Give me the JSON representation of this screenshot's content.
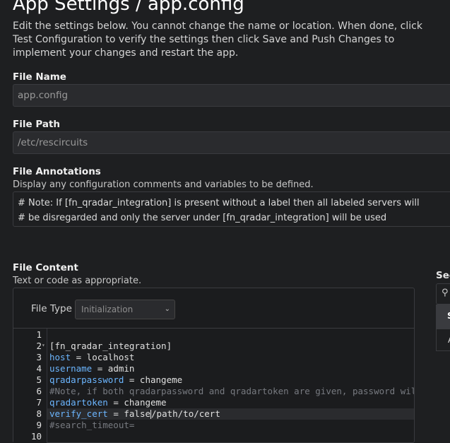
{
  "header": {
    "title": "App Settings / app.config",
    "description": "Edit the settings below. You cannot change the name or location. When done, click Test Configuration to verify the settings then click Save and Push Changes to implement your changes and restart the app."
  },
  "file_name": {
    "label": "File Name",
    "value": "app.config"
  },
  "file_path": {
    "label": "File Path",
    "value": "/etc/rescircuits"
  },
  "annotations": {
    "label": "File Annotations",
    "help": "Display any configuration comments and variables to be defined.",
    "lines": [
      "# Note: If [fn_qradar_integration] is present without a label then all labeled servers will",
      "# be disregarded and only the server under [fn_qradar_integration] will be used"
    ]
  },
  "content": {
    "label": "File Content",
    "help": "Text or code as appropriate.",
    "file_type_label": "File Type",
    "file_type_value": "Initialization",
    "line_numbers": [
      "1",
      "2",
      "3",
      "4",
      "5",
      "6",
      "7",
      "8",
      "9",
      "10"
    ],
    "code": {
      "l2": "[fn_qradar_integration]",
      "l3_key": "host",
      "l3_val": " = localhost",
      "l4_key": "username",
      "l4_val": " = admin",
      "l5_key": "qradarpassword",
      "l5_val": " = changeme",
      "l6": "#Note, if both qradarpassword and qradartoken are given, password will",
      "l7_key": "qradartoken",
      "l7_val": " = changeme",
      "l8_key": "verify_cert",
      "l8_val_a": " = false",
      "l8_val_b": "/path/to/cert",
      "l9": "#search_timeout="
    }
  },
  "side_panel": {
    "label": "Sec",
    "row1": "S",
    "row2": "A"
  }
}
